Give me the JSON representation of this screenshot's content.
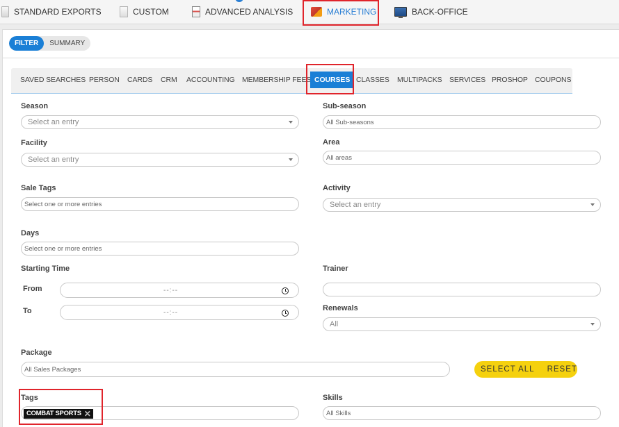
{
  "topnav": {
    "items": [
      {
        "label": "STANDARD EXPORTS",
        "icon": "document-icon"
      },
      {
        "label": "CUSTOM",
        "icon": "document-icon"
      },
      {
        "label": "ADVANCED ANALYSIS",
        "icon": "report-icon"
      },
      {
        "label": "MARKETING",
        "icon": "marketing-icon"
      },
      {
        "label": "BACK-OFFICE",
        "icon": "monitor-icon"
      }
    ],
    "active": "MARKETING"
  },
  "view_toggle": {
    "filter": "FILTER",
    "summary": "SUMMARY",
    "active": "FILTER"
  },
  "subtabs": {
    "items": [
      "SAVED SEARCHES",
      "PERSON",
      "CARDS",
      "CRM",
      "ACCOUNTING",
      "MEMBERSHIP FEES",
      "COURSES",
      "CLASSES",
      "MULTIPACKS",
      "SERVICES",
      "PROSHOP",
      "COUPONS"
    ],
    "active": "COURSES"
  },
  "form": {
    "season": {
      "label": "Season",
      "placeholder": "Select an entry"
    },
    "subseason": {
      "label": "Sub-season",
      "placeholder": "All Sub-seasons"
    },
    "facility": {
      "label": "Facility",
      "placeholder": "Select an entry"
    },
    "area": {
      "label": "Area",
      "placeholder": "All areas"
    },
    "sale_tags": {
      "label": "Sale Tags",
      "placeholder": "Select one or more entries"
    },
    "activity": {
      "label": "Activity",
      "placeholder": "Select an entry"
    },
    "days": {
      "label": "Days",
      "placeholder": "Select one or more entries"
    },
    "starting_time": {
      "label": "Starting Time",
      "from_label": "From",
      "to_label": "To",
      "from_value": "--:--",
      "to_value": "--:--"
    },
    "trainer": {
      "label": "Trainer",
      "value": ""
    },
    "renewals": {
      "label": "Renewals",
      "value": "All"
    },
    "package": {
      "label": "Package",
      "placeholder": "All Sales Packages"
    },
    "buttons": {
      "select_all": "SELECT ALL",
      "reset": "RESET"
    },
    "tags": {
      "label": "Tags",
      "selected": [
        "COMBAT SPORTS"
      ]
    },
    "skills": {
      "label": "Skills",
      "placeholder": "All Skills"
    }
  },
  "colors": {
    "accent": "#1a7fd6",
    "highlight": "#e0242b",
    "button": "#f5d10e"
  }
}
